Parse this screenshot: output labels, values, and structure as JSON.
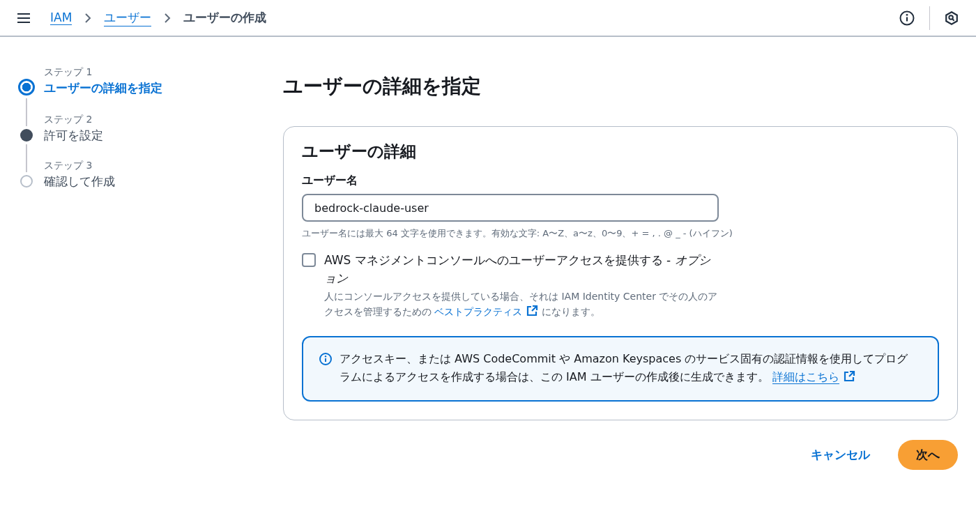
{
  "breadcrumbs": [
    {
      "label": "IAM",
      "link": true
    },
    {
      "label": "ユーザー",
      "link": true
    },
    {
      "label": "ユーザーの作成",
      "link": false
    }
  ],
  "steps": [
    {
      "caption": "ステップ 1",
      "title": "ユーザーの詳細を指定",
      "kind": "current"
    },
    {
      "caption": "ステップ 2",
      "title": "許可を設定",
      "kind": "next"
    },
    {
      "caption": "ステップ 3",
      "title": "確認して作成",
      "kind": "upcoming"
    }
  ],
  "page_title": "ユーザーの詳細を指定",
  "card": {
    "title": "ユーザーの詳細",
    "username": {
      "label": "ユーザー名",
      "value": "bedrock-claude-user",
      "hint": "ユーザー名には最大 64 文字を使用できます。有効な文字: A〜Z、a〜z、0〜9、+ = , . @ _ - (ハイフン)"
    },
    "console_access": {
      "label": "AWS マネジメントコンソールへのユーザーアクセスを提供する - *オプション*",
      "checked": false,
      "description_before": "人にコンソールアクセスを提供している場合、それは IAM Identity Center でその人のアクセスを管理するための ",
      "link": "ベストプラクティス",
      "description_after": " になります。"
    },
    "info": {
      "text": "アクセスキー、または AWS CodeCommit や Amazon Keyspaces のサービス固有の認証情報を使用してプログラムによるアクセスを作成する場合は、この IAM ユーザーの作成後に生成できます。 ",
      "link": "詳細はこちら"
    }
  },
  "buttons": {
    "cancel": "キャンセル",
    "next": "次へ"
  }
}
